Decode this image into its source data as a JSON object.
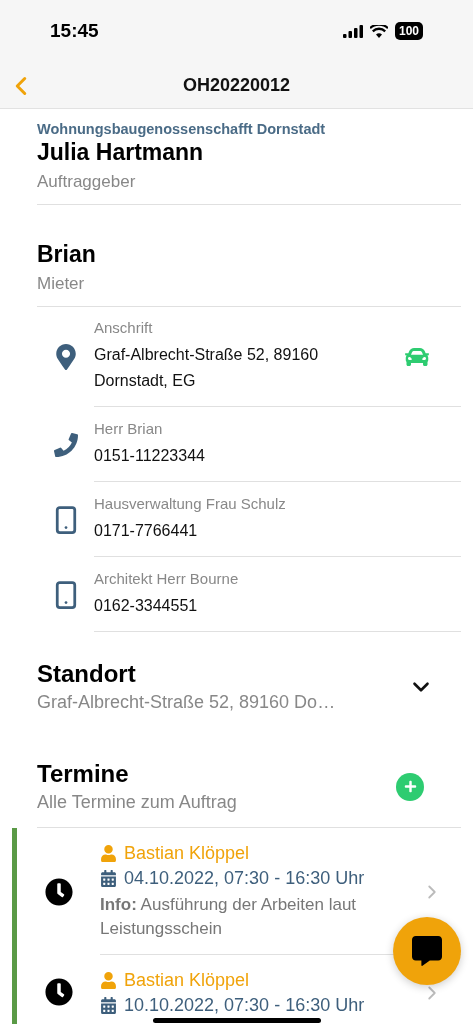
{
  "status_bar": {
    "time": "15:45",
    "battery": "100"
  },
  "nav": {
    "title": "OH20220012"
  },
  "persons": [
    {
      "org": "Wohnungsbaugenossenschafft Dornstadt",
      "name": "Julia Hartmann",
      "role": "Auftraggeber"
    },
    {
      "name": "Brian",
      "role": "Mieter"
    }
  ],
  "contacts": [
    {
      "kind": "address",
      "label": "Anschrift",
      "value": "Graf-Albrecht-Straße 52, 89160 Dornstadt, EG"
    },
    {
      "kind": "phone",
      "label": "Herr Brian",
      "value": "0151-11223344"
    },
    {
      "kind": "mobile",
      "label": "Hausverwaltung Frau Schulz",
      "value": "0171-7766441"
    },
    {
      "kind": "mobile",
      "label": "Architekt Herr Bourne",
      "value": "0162-3344551"
    }
  ],
  "location": {
    "title": "Standort",
    "value": "Graf-Albrecht-Straße 52, 89160 Do…",
    "expanded": false
  },
  "appointments": {
    "title": "Termine",
    "subtitle": "Alle Termine zum Auftrag",
    "items": [
      {
        "person": "Bastian Klöppel",
        "date": "04.10.2022, 07:30 - 16:30 Uhr",
        "info": "**Info:** Ausführung der Arbeiten laut Leistungsschein"
      },
      {
        "person": "Bastian Klöppel",
        "date": "10.10.2022, 07:30 - 16:30 Uhr"
      }
    ]
  }
}
